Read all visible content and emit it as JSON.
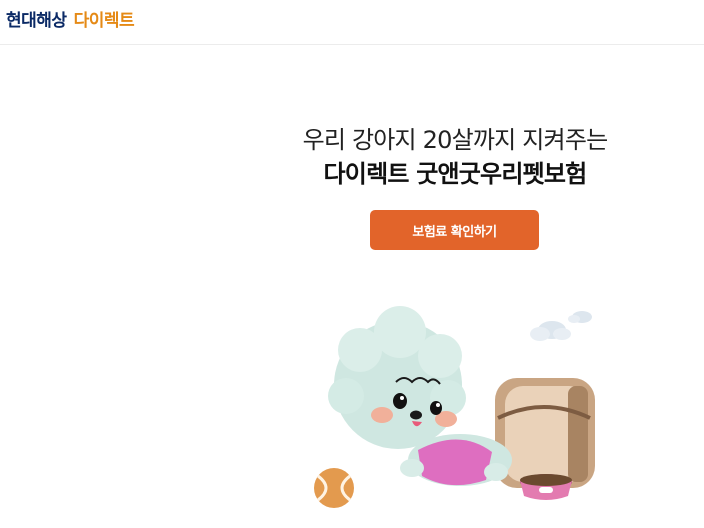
{
  "header": {
    "logo_brand": "현대해상",
    "logo_sub": "다이렉트"
  },
  "hero": {
    "line1": "우리 강아지 20살까지 지켜주는",
    "line2": "다이렉트 굿앤굿우리펫보험",
    "cta_label": "보험료 확인하기"
  },
  "colors": {
    "brand_navy": "#0b2a66",
    "brand_orange": "#e58a16",
    "cta": "#e2642a"
  }
}
